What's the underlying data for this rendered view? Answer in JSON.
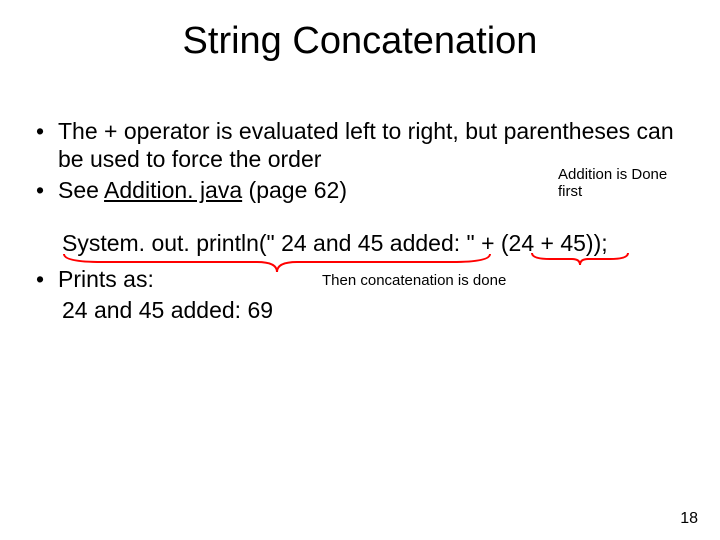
{
  "title": "String Concatenation",
  "bullets": {
    "b1": "The + operator is evaluated left to right, but parentheses can be used to force the order",
    "b2_pre": "See ",
    "b2_link": "Addition. java",
    "b2_post": " (page 62)",
    "b3": "Prints as:"
  },
  "code_line": "System. out. println(\" 24 and 45 added: \" + (24 + 45));",
  "prints_output": "24 and 45 added: 69",
  "annotations": {
    "addition_first": "Addition is Done first",
    "then_concat": "Then concatenation is done"
  },
  "colors": {
    "brace": "#ff0000"
  },
  "page_number": "18"
}
